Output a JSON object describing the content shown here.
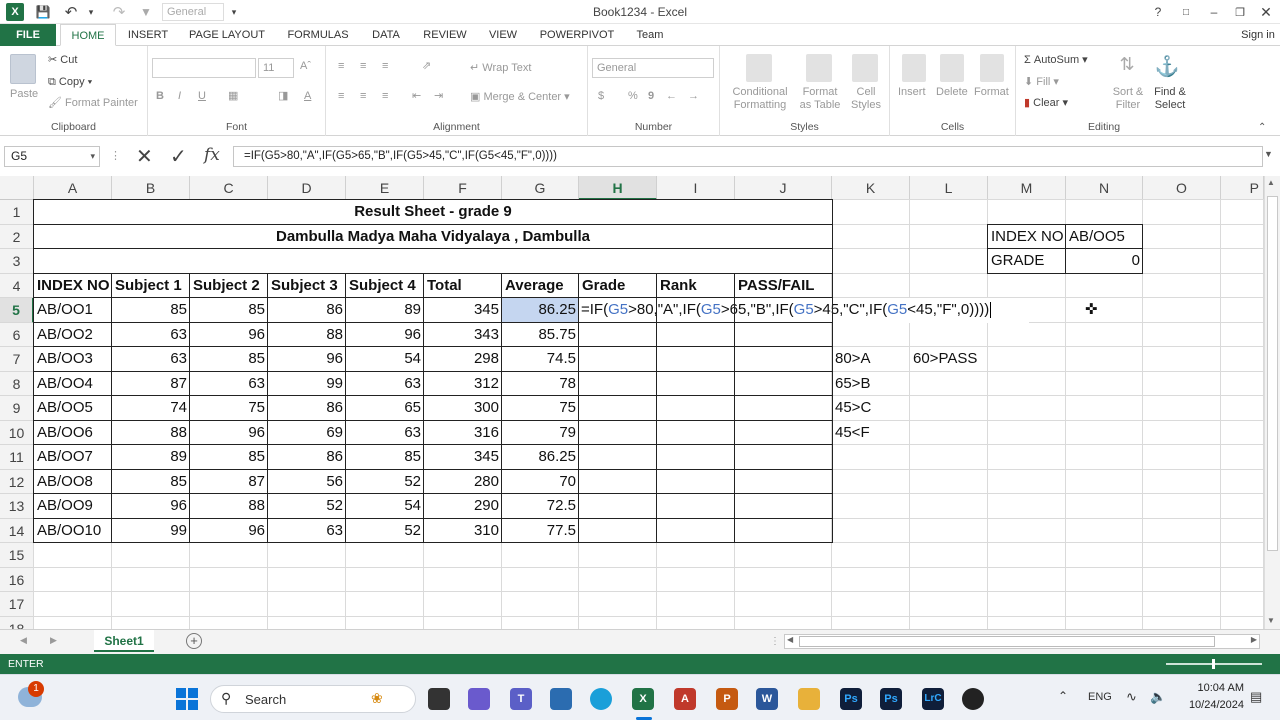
{
  "titlebar": {
    "title": "Book1234 - Excel",
    "font_box": "General",
    "help": "?",
    "signin": "Sign in"
  },
  "tabs": [
    "FILE",
    "HOME",
    "INSERT",
    "PAGE LAYOUT",
    "FORMULAS",
    "DATA",
    "REVIEW",
    "VIEW",
    "POWERPIVOT",
    "Team"
  ],
  "ribbon": {
    "clipboard": {
      "paste": "Paste",
      "cut": "Cut",
      "copy": "Copy",
      "format_painter": "Format Painter",
      "label": "Clipboard"
    },
    "font": {
      "size": "11",
      "bold": "B",
      "italic": "I",
      "underline": "U",
      "label": "Font"
    },
    "alignment": {
      "wrap": "Wrap Text",
      "merge": "Merge & Center",
      "label": "Alignment"
    },
    "number": {
      "format": "General",
      "currency": "$",
      "percent": "%",
      "comma": "9",
      "label": "Number"
    },
    "styles": {
      "cond": "Conditional Formatting",
      "table": "Format as Table",
      "cell": "Cell Styles",
      "label": "Styles"
    },
    "cells": {
      "insert": "Insert",
      "delete": "Delete",
      "format": "Format",
      "label": "Cells"
    },
    "editing": {
      "autosum": "AutoSum",
      "fill": "Fill",
      "clear": "Clear",
      "sort": "Sort & Filter",
      "find": "Find & Select",
      "label": "Editing"
    }
  },
  "formula_bar": {
    "name_box": "G5",
    "formula": "=IF(G5>80,\"A\",IF(G5>65,\"B\",IF(G5>45,\"C\",IF(G5<45,\"F\",0))))"
  },
  "columns": [
    "A",
    "B",
    "C",
    "D",
    "E",
    "F",
    "G",
    "H",
    "I",
    "J",
    "K",
    "L",
    "M",
    "N",
    "O",
    "P"
  ],
  "selected_column": "H",
  "selected_row": "5",
  "rows": [
    "1",
    "2",
    "3",
    "4",
    "5",
    "6",
    "7",
    "8",
    "9",
    "10",
    "11",
    "12",
    "13",
    "14",
    "15",
    "16",
    "17",
    "18"
  ],
  "sheet": {
    "title": "Result Sheet - grade 9",
    "school": "Dambulla Madya Maha Vidyalaya , Dambulla",
    "headers": [
      "INDEX NO",
      "Subject 1",
      "Subject 2",
      "Subject 3",
      "Subject 4",
      "Total",
      "Average",
      "Grade",
      "Rank",
      "PASS/FAIL"
    ],
    "records": [
      [
        "AB/OO1",
        "85",
        "85",
        "86",
        "89",
        "345",
        "86.25"
      ],
      [
        "AB/OO2",
        "63",
        "96",
        "88",
        "96",
        "343",
        "85.75"
      ],
      [
        "AB/OO3",
        "63",
        "85",
        "96",
        "54",
        "298",
        "74.5"
      ],
      [
        "AB/OO4",
        "87",
        "63",
        "99",
        "63",
        "312",
        "78"
      ],
      [
        "AB/OO5",
        "74",
        "75",
        "86",
        "65",
        "300",
        "75"
      ],
      [
        "AB/OO6",
        "88",
        "96",
        "69",
        "63",
        "316",
        "79"
      ],
      [
        "AB/OO7",
        "89",
        "85",
        "86",
        "85",
        "345",
        "86.25"
      ],
      [
        "AB/OO8",
        "85",
        "87",
        "56",
        "52",
        "280",
        "70"
      ],
      [
        "AB/OO9",
        "96",
        "88",
        "52",
        "54",
        "290",
        "72.5"
      ],
      [
        "AB/OO10",
        "99",
        "96",
        "63",
        "52",
        "310",
        "77.5"
      ]
    ],
    "editing_formula": "=IF(G5>80,\"A\",IF(G5>65,\"B\",IF(G5>45,\"C\",IF(G5<45,\"F\",0))))",
    "notes": [
      "80>A",
      "65>B",
      "45>C",
      "45<F"
    ],
    "pass_note": "60>PASS",
    "lookup": {
      "index_label": "INDEX NO",
      "index_value": "AB/OO5",
      "grade_label": "GRADE",
      "grade_value": "0"
    }
  },
  "sheet_tab": "Sheet1",
  "status": "ENTER",
  "taskbar": {
    "search": "Search",
    "lang": "ENG",
    "time": "10:04 AM",
    "date": "10/24/2024",
    "badge": "1"
  },
  "colors": {
    "excel_green": "#217346",
    "ref_blue": "#4472c4"
  }
}
